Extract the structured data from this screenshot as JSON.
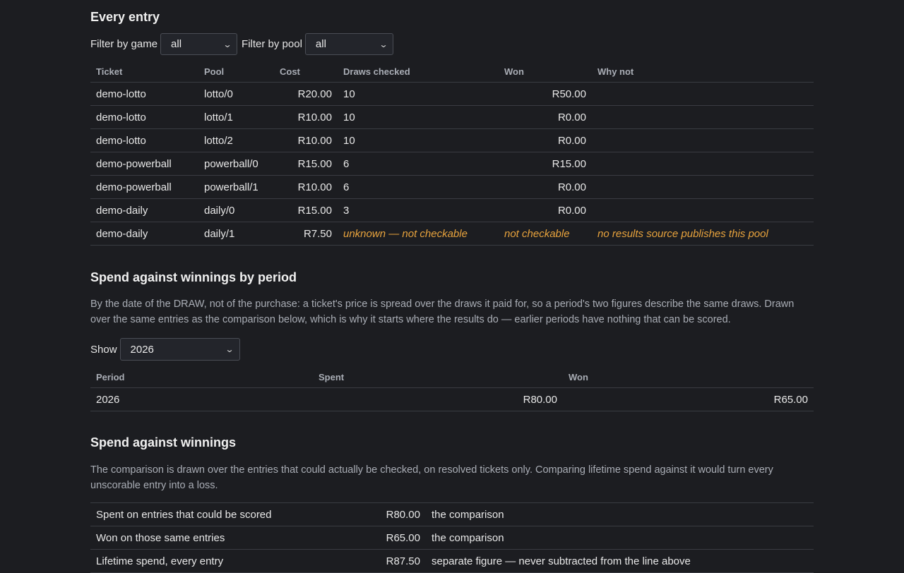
{
  "entries_section": {
    "title": "Every entry",
    "filter_game_label": "Filter by game",
    "filter_game_value": "all",
    "filter_pool_label": "Filter by pool",
    "filter_pool_value": "all",
    "headers": [
      "Ticket",
      "Pool",
      "Cost",
      "Draws checked",
      "Won",
      "Why not"
    ],
    "rows": [
      {
        "ticket": "demo-lotto",
        "pool": "lotto/0",
        "cost": "R20.00",
        "draws": "10",
        "won": "R50.00",
        "why": ""
      },
      {
        "ticket": "demo-lotto",
        "pool": "lotto/1",
        "cost": "R10.00",
        "draws": "10",
        "won": "R0.00",
        "why": ""
      },
      {
        "ticket": "demo-lotto",
        "pool": "lotto/2",
        "cost": "R10.00",
        "draws": "10",
        "won": "R0.00",
        "why": ""
      },
      {
        "ticket": "demo-powerball",
        "pool": "powerball/0",
        "cost": "R15.00",
        "draws": "6",
        "won": "R15.00",
        "why": ""
      },
      {
        "ticket": "demo-powerball",
        "pool": "powerball/1",
        "cost": "R10.00",
        "draws": "6",
        "won": "R0.00",
        "why": ""
      },
      {
        "ticket": "demo-daily",
        "pool": "daily/0",
        "cost": "R15.00",
        "draws": "3",
        "won": "R0.00",
        "why": ""
      },
      {
        "ticket": "demo-daily",
        "pool": "daily/1",
        "cost": "R7.50",
        "draws": "unknown — not checkable",
        "won": "not checkable",
        "why": "no results source publishes this pool"
      }
    ]
  },
  "period_section": {
    "title": "Spend against winnings by period",
    "description": "By the date of the DRAW, not of the purchase: a ticket's price is spread over the draws it paid for, so a period's two figures describe the same draws. Drawn over the same entries as the comparison below, which is why it starts where the results do — earlier periods have nothing that can be scored.",
    "show_label": "Show",
    "show_value": "2026",
    "headers": [
      "Period",
      "Spent",
      "Won"
    ],
    "rows": [
      {
        "period": "2026",
        "spent": "R80.00",
        "won": "R65.00"
      }
    ]
  },
  "spend_section": {
    "title": "Spend against winnings",
    "description": "The comparison is drawn over the entries that could actually be checked, on resolved tickets only. Comparing lifetime spend against it would turn every unscorable entry into a loss.",
    "rows": [
      {
        "label": "Spent on entries that could be scored",
        "amount": "R80.00",
        "note": "the comparison"
      },
      {
        "label": "Won on those same entries",
        "amount": "R65.00",
        "note": "the comparison"
      },
      {
        "label": "Lifetime spend, every entry",
        "amount": "R87.50",
        "note": "separate figure — never subtracted from the line above"
      }
    ]
  },
  "colors": {
    "background": "#1c1d21",
    "warning": "#e8a33d",
    "muted_text": "#a9adb5"
  }
}
